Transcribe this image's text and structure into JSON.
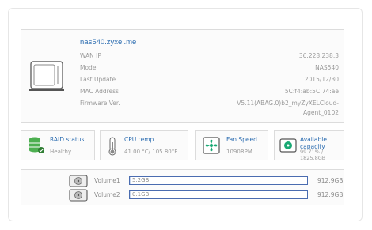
{
  "device": {
    "hostname": "nas540.zyxel.me",
    "fields": [
      {
        "label": "WAN IP",
        "value": "36.228.238.3"
      },
      {
        "label": "Model",
        "value": "NAS540"
      },
      {
        "label": "Last Update",
        "value": "2015/12/30"
      },
      {
        "label": "MAC Address",
        "value": "5C:f4:ab:5C:74:ae"
      },
      {
        "label": "Firmware Ver.",
        "value": "V5.11(ABAG.0)b2_myZyXELCloud-"
      },
      {
        "label": "",
        "value": "Agent_0102"
      }
    ]
  },
  "stats": {
    "raid": {
      "title": "RAID status",
      "value": "Healthy",
      "color": "#4caf50"
    },
    "cpu": {
      "title": "CPU temp",
      "value": "41.00 °C/ 105.80°F"
    },
    "fan": {
      "title": "Fan Speed",
      "value": "1090RPM",
      "color": "#19a974"
    },
    "capacity": {
      "title": "Available capacity",
      "value": "99.71% / 1825.8GB",
      "color": "#19a974"
    }
  },
  "volumes": [
    {
      "name": "Volume1",
      "used": "5.2GB",
      "total": "912.9GB",
      "fraction": 0.006
    },
    {
      "name": "Volume2",
      "used": "0.1GB",
      "total": "912.9GB",
      "fraction": 0.0001
    }
  ]
}
